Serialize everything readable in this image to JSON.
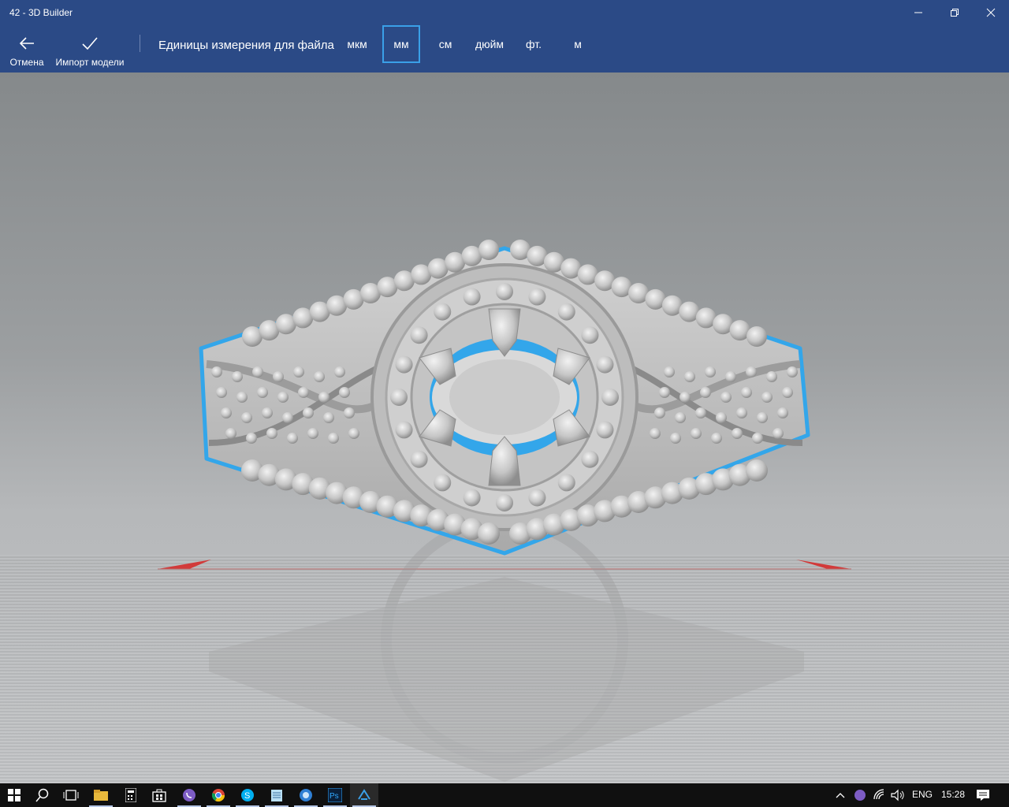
{
  "window": {
    "title": "42 - 3D Builder"
  },
  "command_bar": {
    "cancel_label": "Отмена",
    "import_label": "Импорт модели",
    "units_label": "Единицы измерения для файла",
    "units": [
      {
        "label": "мкм",
        "selected": false
      },
      {
        "label": "мм",
        "selected": true
      },
      {
        "label": "см",
        "selected": false
      },
      {
        "label": "дюйм",
        "selected": false
      },
      {
        "label": "фт.",
        "selected": false
      },
      {
        "label": "м",
        "selected": false
      }
    ]
  },
  "colors": {
    "accent": "#2b4a86",
    "selection": "#3aa0e8",
    "model": "#c8c8c8",
    "axis": "#d23a3a"
  },
  "taskbar": {
    "apps": [
      "windows-start-icon",
      "search-icon",
      "task-view-icon",
      "file-explorer-icon",
      "calculator-icon",
      "store-icon",
      "viber-icon",
      "chrome-icon",
      "skype-icon",
      "notepad-icon",
      "browser-icon",
      "photoshop-icon",
      "3d-builder-icon"
    ],
    "photoshop_text": "Ps",
    "language": "ENG",
    "time": "15:28"
  }
}
